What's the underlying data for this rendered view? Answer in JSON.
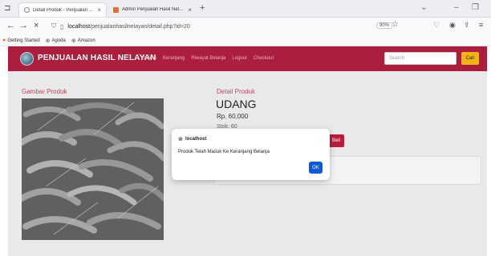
{
  "browser": {
    "tabs": [
      {
        "label": "Detail Produk - Penjualan Hasil",
        "close": "×"
      },
      {
        "label": "Admin Penjualan Hasil Nelayan",
        "close": "×"
      }
    ],
    "new_tab": "+",
    "url": {
      "host": "localhost",
      "path": "/penjualanhasilnelayan/detail.php?id=20"
    },
    "zoom": "90%",
    "bookmarks": [
      "Getting Started",
      "Agoda",
      "Amazon"
    ]
  },
  "site": {
    "brand": "PENJUALAN HASIL NELAYAN",
    "menu": [
      "Home",
      "Keranjang",
      "Riwayat Belanja",
      "Logout",
      "Checkout"
    ],
    "search_placeholder": "Search",
    "search_button": "Cari"
  },
  "page": {
    "image_heading": "Gambar Produk",
    "detail_heading": "Detail Produk",
    "product_name": "UDANG",
    "price": "Rp. 60,000",
    "stock": "Stok: 60",
    "buy_button": "Beli"
  },
  "dialog": {
    "host": "localhost",
    "message": "Produk Telah Masuk Ke Keranjang Belanja",
    "ok": "OK"
  },
  "colors": {
    "header": "#ab1e3e",
    "accent": "#c0485d",
    "search_button": "#f0b419",
    "ok_button": "#0b5ad7"
  }
}
